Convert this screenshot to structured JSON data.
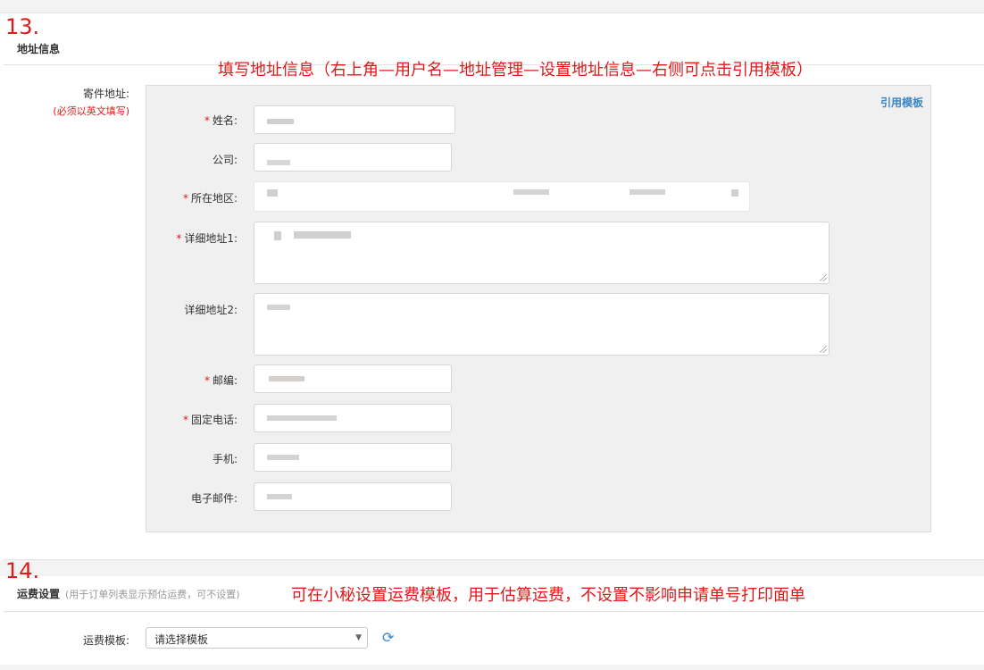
{
  "steps": {
    "step13": "13.",
    "step14": "14."
  },
  "address_section": {
    "title": "地址信息",
    "annotation": "填写地址信息（右上角—用户名—地址管理—设置地址信息—右侧可点击引用模板）",
    "sender_label": "寄件地址:",
    "sender_note": "(必须以英文填写)",
    "use_template": "引用模板",
    "fields": {
      "name": {
        "label": "姓名:",
        "required": true
      },
      "company": {
        "label": "公司:",
        "required": false
      },
      "region": {
        "label": "所在地区:",
        "required": true
      },
      "address1": {
        "label": "详细地址1:",
        "required": true
      },
      "address2": {
        "label": "详细地址2:",
        "required": false
      },
      "postcode": {
        "label": "邮编:",
        "required": true
      },
      "phone": {
        "label": "固定电话:",
        "required": true
      },
      "mobile": {
        "label": "手机:",
        "required": false
      },
      "email": {
        "label": "电子邮件:",
        "required": false
      }
    },
    "required_mark": "*"
  },
  "shipping_section": {
    "title": "运费设置",
    "subtitle": "(用于订单列表显示预估运费，可不设置)",
    "annotation": "可在小秘设置运费模板，用于估算运费，不设置不影响申请单号打印面单",
    "template_label": "运费模板:",
    "template_select": "请选择模板"
  },
  "icons": {
    "caret": "chevron-down-icon",
    "refresh": "refresh-icon"
  },
  "colors": {
    "annotation": "#e0191a",
    "link": "#3b86c9"
  }
}
